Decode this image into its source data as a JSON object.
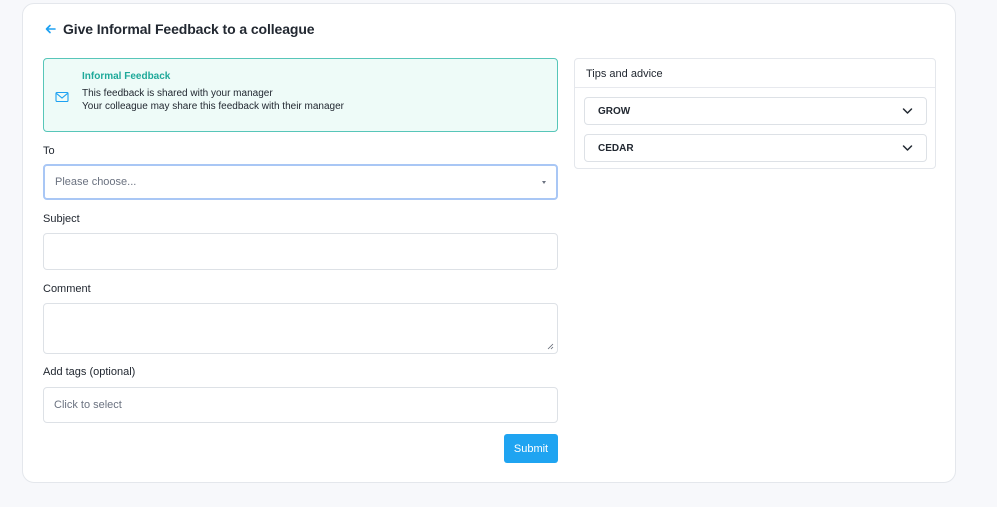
{
  "page": {
    "title": "Give Informal Feedback to a colleague"
  },
  "info": {
    "title": "Informal Feedback",
    "line1": "This feedback is shared with your manager",
    "line2": "Your colleague may share this feedback with their manager"
  },
  "form": {
    "to_label": "To",
    "to_placeholder": "Please choose...",
    "subject_label": "Subject",
    "comment_label": "Comment",
    "tags_label": "Add tags (optional)",
    "tags_placeholder": "Click to select",
    "submit_label": "Submit"
  },
  "tips": {
    "title": "Tips and advice",
    "items": [
      {
        "label": "GROW"
      },
      {
        "label": "CEDAR"
      }
    ]
  },
  "colors": {
    "accent": "#1fa4f1",
    "info_border": "#57c6b9",
    "info_background": "#eefbf8",
    "info_title": "#1fa99a",
    "focus_border": "#a9c7f5"
  },
  "icons": {
    "back": "back-arrow-icon",
    "info": "mail-icon",
    "accordion": "chevron-down-icon",
    "select": "caret-down-icon"
  }
}
